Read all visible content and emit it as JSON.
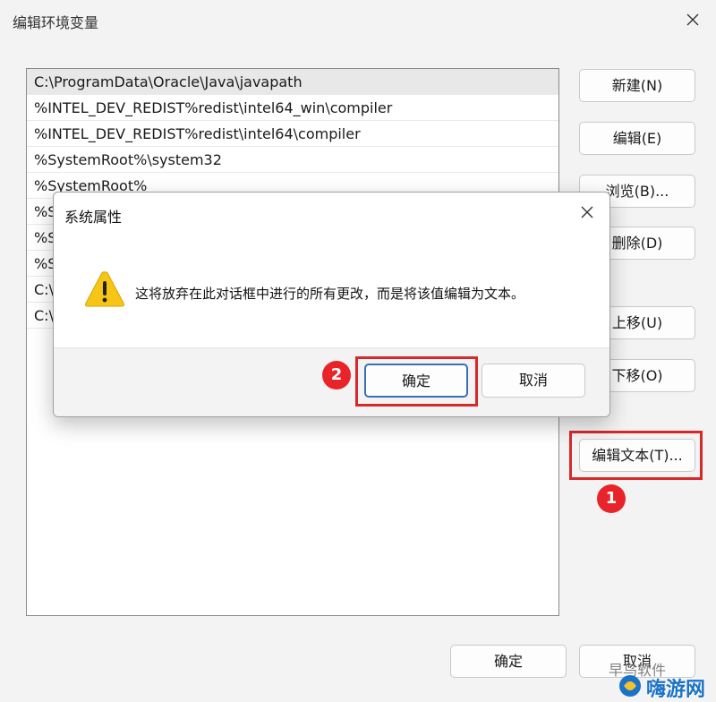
{
  "window": {
    "title": "编辑环境变量"
  },
  "path_list": [
    "C:\\ProgramData\\Oracle\\Java\\javapath",
    "%INTEL_DEV_REDIST%redist\\intel64_win\\compiler",
    "%INTEL_DEV_REDIST%redist\\intel64\\compiler",
    "%SystemRoot%\\system32",
    "%SystemRoot%",
    "%S",
    "%S",
    "%S",
    "C:\\",
    "C:\\"
  ],
  "side_buttons": {
    "new": "新建(N)",
    "edit": "编辑(E)",
    "browse": "浏览(B)...",
    "delete": "删除(D)",
    "move_up": "上移(U)",
    "move_down": "下移(O)",
    "edit_text": "编辑文本(T)..."
  },
  "bottom_buttons": {
    "ok": "确定",
    "cancel": "取消"
  },
  "dialog": {
    "title": "系统属性",
    "message": "这将放弃在此对话框中进行的所有更改，而是将该值编辑为文本。",
    "ok": "确定",
    "cancel": "取消"
  },
  "annotations": {
    "step1": "1",
    "step2": "2",
    "accent_color": "#e8242a"
  },
  "watermark": {
    "text": "早鸟软件",
    "brand": "嗨游网"
  }
}
